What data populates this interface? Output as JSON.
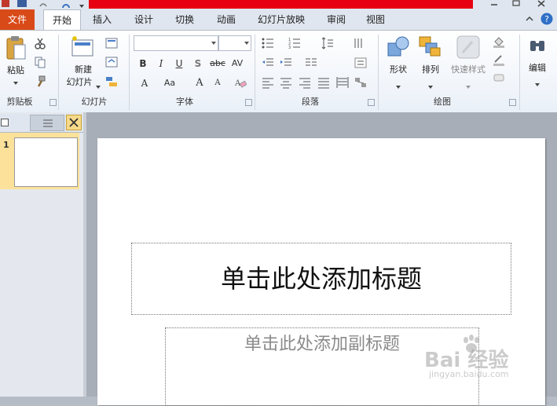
{
  "colors": {
    "file_tab": "#d94a19",
    "banner": "#e60012",
    "selected_thumb": "#fbe19a"
  },
  "tabs": [
    {
      "label": "文件"
    },
    {
      "label": "开始"
    },
    {
      "label": "插入"
    },
    {
      "label": "设计"
    },
    {
      "label": "切换"
    },
    {
      "label": "动画"
    },
    {
      "label": "幻灯片放映"
    },
    {
      "label": "审阅"
    },
    {
      "label": "视图"
    }
  ],
  "ribbon": {
    "clipboard": {
      "paste": "粘贴",
      "group": "剪贴板"
    },
    "slides": {
      "new_line1": "新建",
      "new_line2": "幻灯片",
      "group": "幻灯片"
    },
    "font": {
      "group": "字体",
      "bold": "B",
      "italic": "I",
      "underline": "U",
      "shadow": "S",
      "strike": "abc",
      "spacing": "AV",
      "fontcolor": "A",
      "case": "Aa",
      "grow": "A",
      "shrink": "A"
    },
    "paragraph": {
      "group": "段落"
    },
    "drawing": {
      "shapes": "形状",
      "arrange": "排列",
      "quick_styles": "快速样式",
      "group": "绘图"
    },
    "editing": {
      "label": "编辑"
    }
  },
  "slide_pane": {
    "slide_number": "1"
  },
  "slide": {
    "title_placeholder": "单击此处添加标题",
    "subtitle_placeholder": "单击此处添加副标题"
  },
  "watermark": {
    "brand": "Bai 经验",
    "site": "jingyan.baidu.com"
  }
}
